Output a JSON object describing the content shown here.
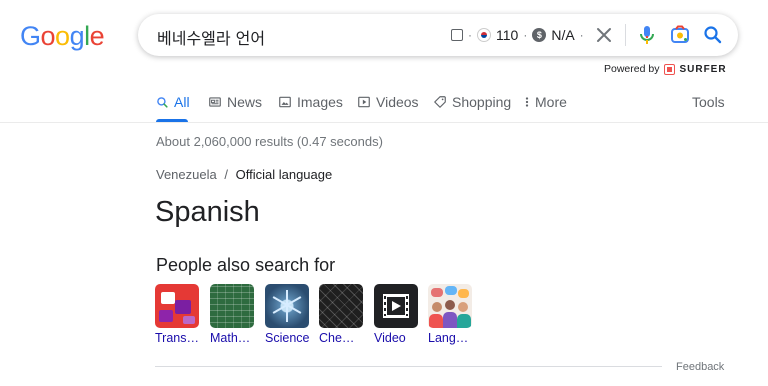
{
  "logo": {
    "text": "Google",
    "colors": [
      "#4285F4",
      "#EA4335",
      "#FBBC05",
      "#4285F4",
      "#34A853",
      "#EA4335"
    ]
  },
  "search": {
    "query": "베네수엘라 언어",
    "extension": {
      "volume": "110",
      "cpc": "N/A",
      "country_flag": "south-korea-flag-icon",
      "currency_icon": "dollar-icon"
    }
  },
  "powered_by": {
    "prefix": "Powered by",
    "brand": "SURFER"
  },
  "tabs": [
    {
      "label": "All",
      "icon": "search-icon",
      "active": true
    },
    {
      "label": "News",
      "icon": "news-icon",
      "active": false
    },
    {
      "label": "Images",
      "icon": "image-icon",
      "active": false
    },
    {
      "label": "Videos",
      "icon": "video-icon",
      "active": false
    },
    {
      "label": "Shopping",
      "icon": "tag-icon",
      "active": false
    },
    {
      "label": "More",
      "icon": "more-vert-icon",
      "active": false
    }
  ],
  "tools_label": "Tools",
  "result_stats": "About 2,060,000 results (0.47 seconds)",
  "breadcrumb": {
    "parent": "Venezuela",
    "separator": "/",
    "current": "Official language"
  },
  "answer": "Spanish",
  "people_also_search": {
    "title": "People also search for",
    "items": [
      {
        "label": "Trans…"
      },
      {
        "label": "Math…"
      },
      {
        "label": "Science"
      },
      {
        "label": "Che…"
      },
      {
        "label": "Video"
      },
      {
        "label": "Lang…"
      }
    ]
  },
  "feedback_label": "Feedback",
  "colors": {
    "accent": "#1a73e8",
    "link": "#1a0dab",
    "muted": "#70757a"
  }
}
